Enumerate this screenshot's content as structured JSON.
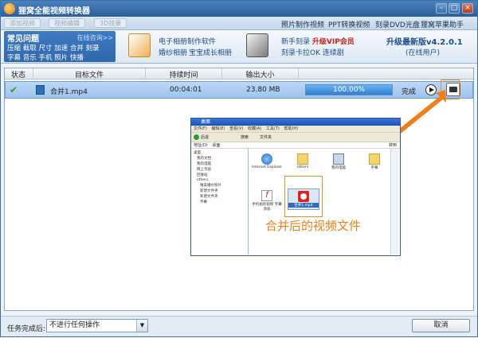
{
  "window": {
    "title": "狸窝全能视频转换器"
  },
  "window_buttons": [
    "-",
    "□",
    "×"
  ],
  "toolbar": {
    "buttons": [
      "添加视频",
      "视频编辑",
      "3D效果"
    ],
    "menus": [
      "照片制作视频",
      "PPT转换视频",
      "刻录DVD光盘",
      "狸窝苹果助手"
    ]
  },
  "faq": {
    "title": "常见问题",
    "more": "在线咨询>>",
    "row1": [
      "压缩",
      "截取",
      "尺寸",
      "加速",
      "合并",
      "刻录"
    ],
    "row2": [
      "字幕",
      "音乐",
      "手机",
      "照片",
      "快播"
    ]
  },
  "promos": {
    "a1": "电子相册制作软件",
    "a2": "婚纱相册",
    "a3": "宝宝成长相册",
    "b1": "新手刻录",
    "b_vip": "升级VIP会员",
    "b2": "刻录卡拉OK",
    "b3": "连续剧"
  },
  "upgrade": {
    "title": "升级最新版v4.2.0.1",
    "status": "(在线用户)"
  },
  "table": {
    "headers": [
      "状态",
      "目标文件",
      "持续时间",
      "输出大小",
      ""
    ],
    "rows": [
      {
        "status": "done",
        "file": "合并1.mp4",
        "duration": "00:04:01",
        "size": "23.80 MB",
        "progress_text": "100.00%",
        "progress": 1.0,
        "state": "完成"
      }
    ]
  },
  "explorer": {
    "title": "桌面",
    "menu": [
      "文件(F)",
      "编辑(E)",
      "查看(V)",
      "收藏(A)",
      "工具(T)",
      "帮助(H)"
    ],
    "back": "后退",
    "search": "搜索",
    "folders_btn": "文件夹",
    "address_label": "地址(D)",
    "address": "桌面",
    "go": "转到",
    "tree": [
      "桌面",
      "我的文档",
      "我的电脑",
      "网上邻居",
      "回收站",
      "others",
      "唯美婚纱照片",
      "新建文件夹",
      "新建文件夹",
      "字幕"
    ],
    "items": [
      {
        "label": "Internet Explorer",
        "icon": "ie-icon"
      },
      {
        "label": "others",
        "icon": "folder-icon"
      },
      {
        "label": "我的电脑",
        "icon": "computer-icon"
      },
      {
        "label": "字幕",
        "icon": "folder-icon"
      },
      {
        "label": "手机拍的视频 字幕添加",
        "icon": "flash-icon"
      },
      {
        "label": "合并1.mp4",
        "icon": "video-icon"
      }
    ]
  },
  "callout": "合并后的视频文件",
  "accent_color": "#f07d16",
  "statusbar": {
    "label": "任务完成后:",
    "select_value": "不进行任何操作",
    "cancel": "取消"
  }
}
